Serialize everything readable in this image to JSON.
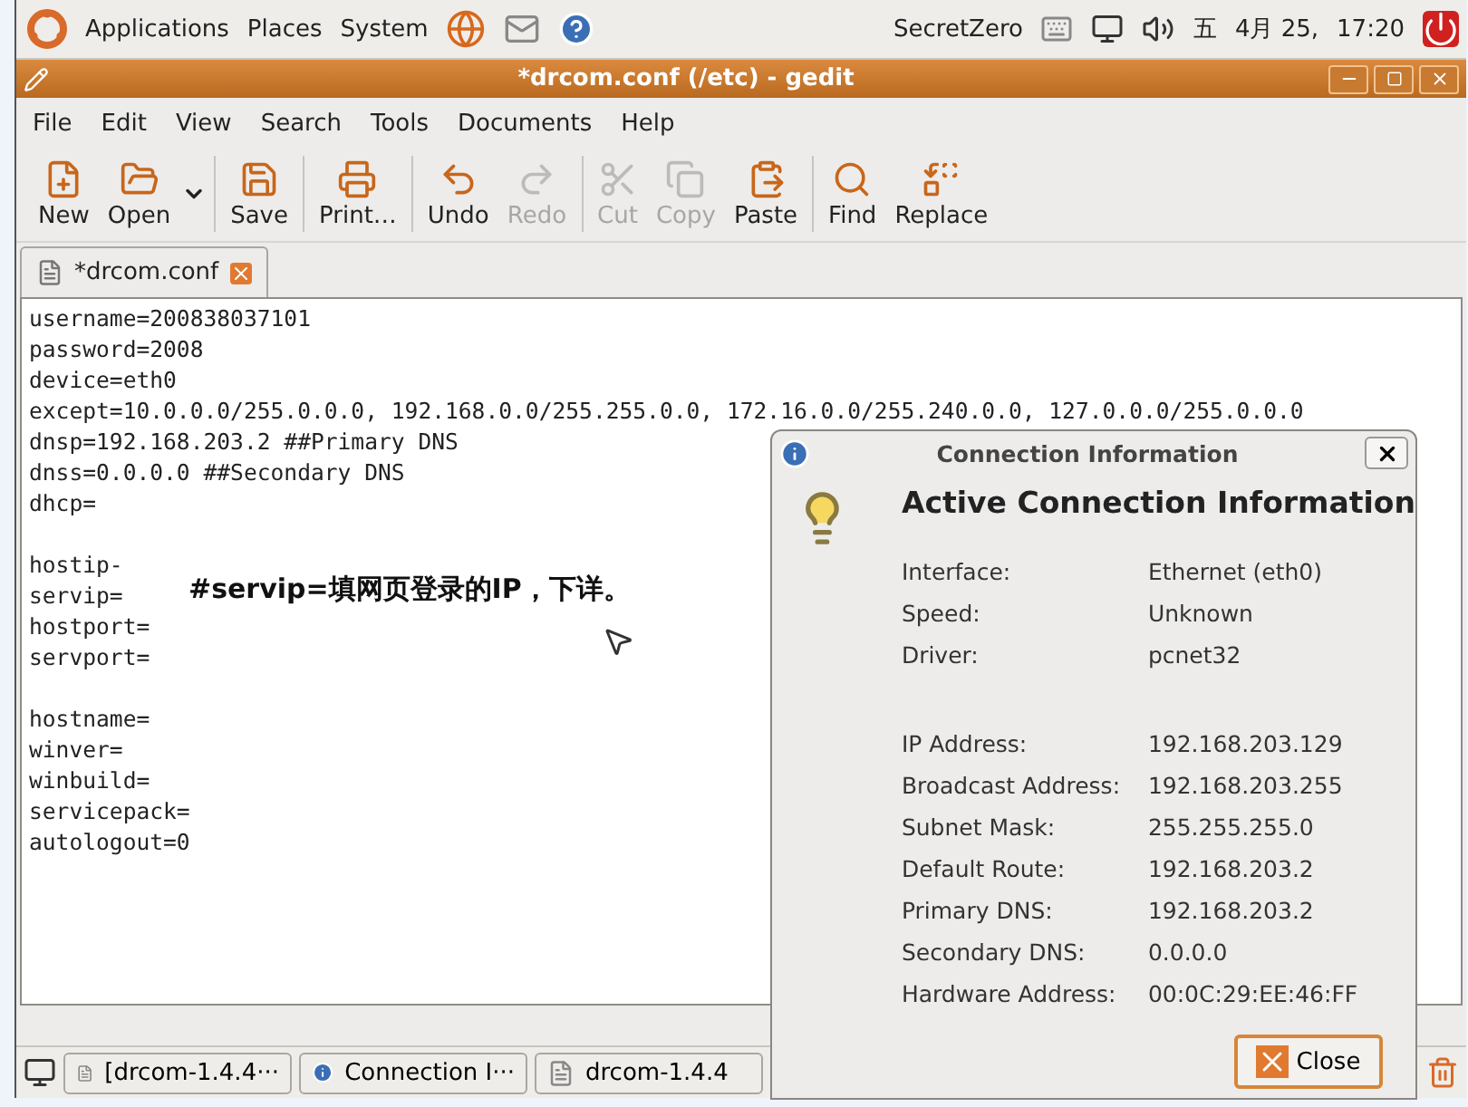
{
  "panel": {
    "menus": [
      "Applications",
      "Places",
      "System"
    ],
    "user": "SecretZero",
    "weekday": "五",
    "date": "4月 25,",
    "time": "17:20"
  },
  "window": {
    "title": "*drcom.conf (/etc) - gedit",
    "menus": [
      "File",
      "Edit",
      "View",
      "Search",
      "Tools",
      "Documents",
      "Help"
    ],
    "toolbar_groups": [
      {
        "items": [
          {
            "kind": "new",
            "label": "New",
            "disabled": false
          },
          {
            "kind": "open",
            "label": "Open",
            "disabled": false
          }
        ]
      },
      {
        "items": [
          {
            "kind": "save",
            "label": "Save",
            "disabled": false
          }
        ]
      },
      {
        "items": [
          {
            "kind": "print",
            "label": "Print…",
            "disabled": false
          }
        ]
      },
      {
        "items": [
          {
            "kind": "undo",
            "label": "Undo",
            "disabled": false
          },
          {
            "kind": "redo",
            "label": "Redo",
            "disabled": true
          }
        ]
      },
      {
        "items": [
          {
            "kind": "cut",
            "label": "Cut",
            "disabled": true
          },
          {
            "kind": "copy",
            "label": "Copy",
            "disabled": true
          },
          {
            "kind": "paste",
            "label": "Paste",
            "disabled": false
          }
        ]
      },
      {
        "items": [
          {
            "kind": "find",
            "label": "Find",
            "disabled": false
          },
          {
            "kind": "replace",
            "label": "Replace",
            "disabled": false
          }
        ]
      }
    ],
    "tabs": [
      {
        "label": "*drcom.conf",
        "selected": true
      }
    ],
    "blocks": [
      {
        "lines": [
          "username=200838037101",
          "password=2008",
          "device=eth0",
          "except=10.0.0.0/255.0.0.0, 192.168.0.0/255.255.0.0, 172.16.0.0/255.240.0.0, 127.0.0.0/255.0.0.0",
          "dnsp=192.168.203.2 ##Primary DNS",
          "dnss=0.0.0.0 ##Secondary DNS",
          "dhcp="
        ]
      },
      {
        "lines": [
          "hostip-",
          "servip=",
          "hostport=",
          "servport="
        ]
      },
      {
        "lines": [
          "hostname=",
          "winver=",
          "winbuild=",
          "servicepack=",
          "autologout=0"
        ]
      }
    ],
    "annotation": "#servip=填网页登录的IP，下详。"
  },
  "taskbar": [
    {
      "kind": "file",
      "label": "[drcom-1.4.4···"
    },
    {
      "kind": "info",
      "label": "Connection I···"
    },
    {
      "kind": "file",
      "label": "drcom-1.4.4"
    }
  ],
  "dialog": {
    "title": "Connection Information",
    "heading": "Active Connection Information",
    "device_rows": [
      {
        "label": "Interface:",
        "value": "Ethernet (eth0)"
      },
      {
        "label": "Speed:",
        "value": "Unknown"
      },
      {
        "label": "Driver:",
        "value": "pcnet32"
      }
    ],
    "address_rows": [
      {
        "label": "IP Address:",
        "value": "192.168.203.129"
      },
      {
        "label": "Broadcast Address:",
        "value": "192.168.203.255"
      },
      {
        "label": "Subnet Mask:",
        "value": "255.255.255.0"
      },
      {
        "label": "Default Route:",
        "value": "192.168.203.2"
      },
      {
        "label": "Primary DNS:",
        "value": "192.168.203.2"
      },
      {
        "label": "Secondary DNS:",
        "value": "0.0.0.0"
      },
      {
        "label": "Hardware Address:",
        "value": "00:0C:29:EE:46:FF"
      }
    ],
    "button": "Close"
  }
}
